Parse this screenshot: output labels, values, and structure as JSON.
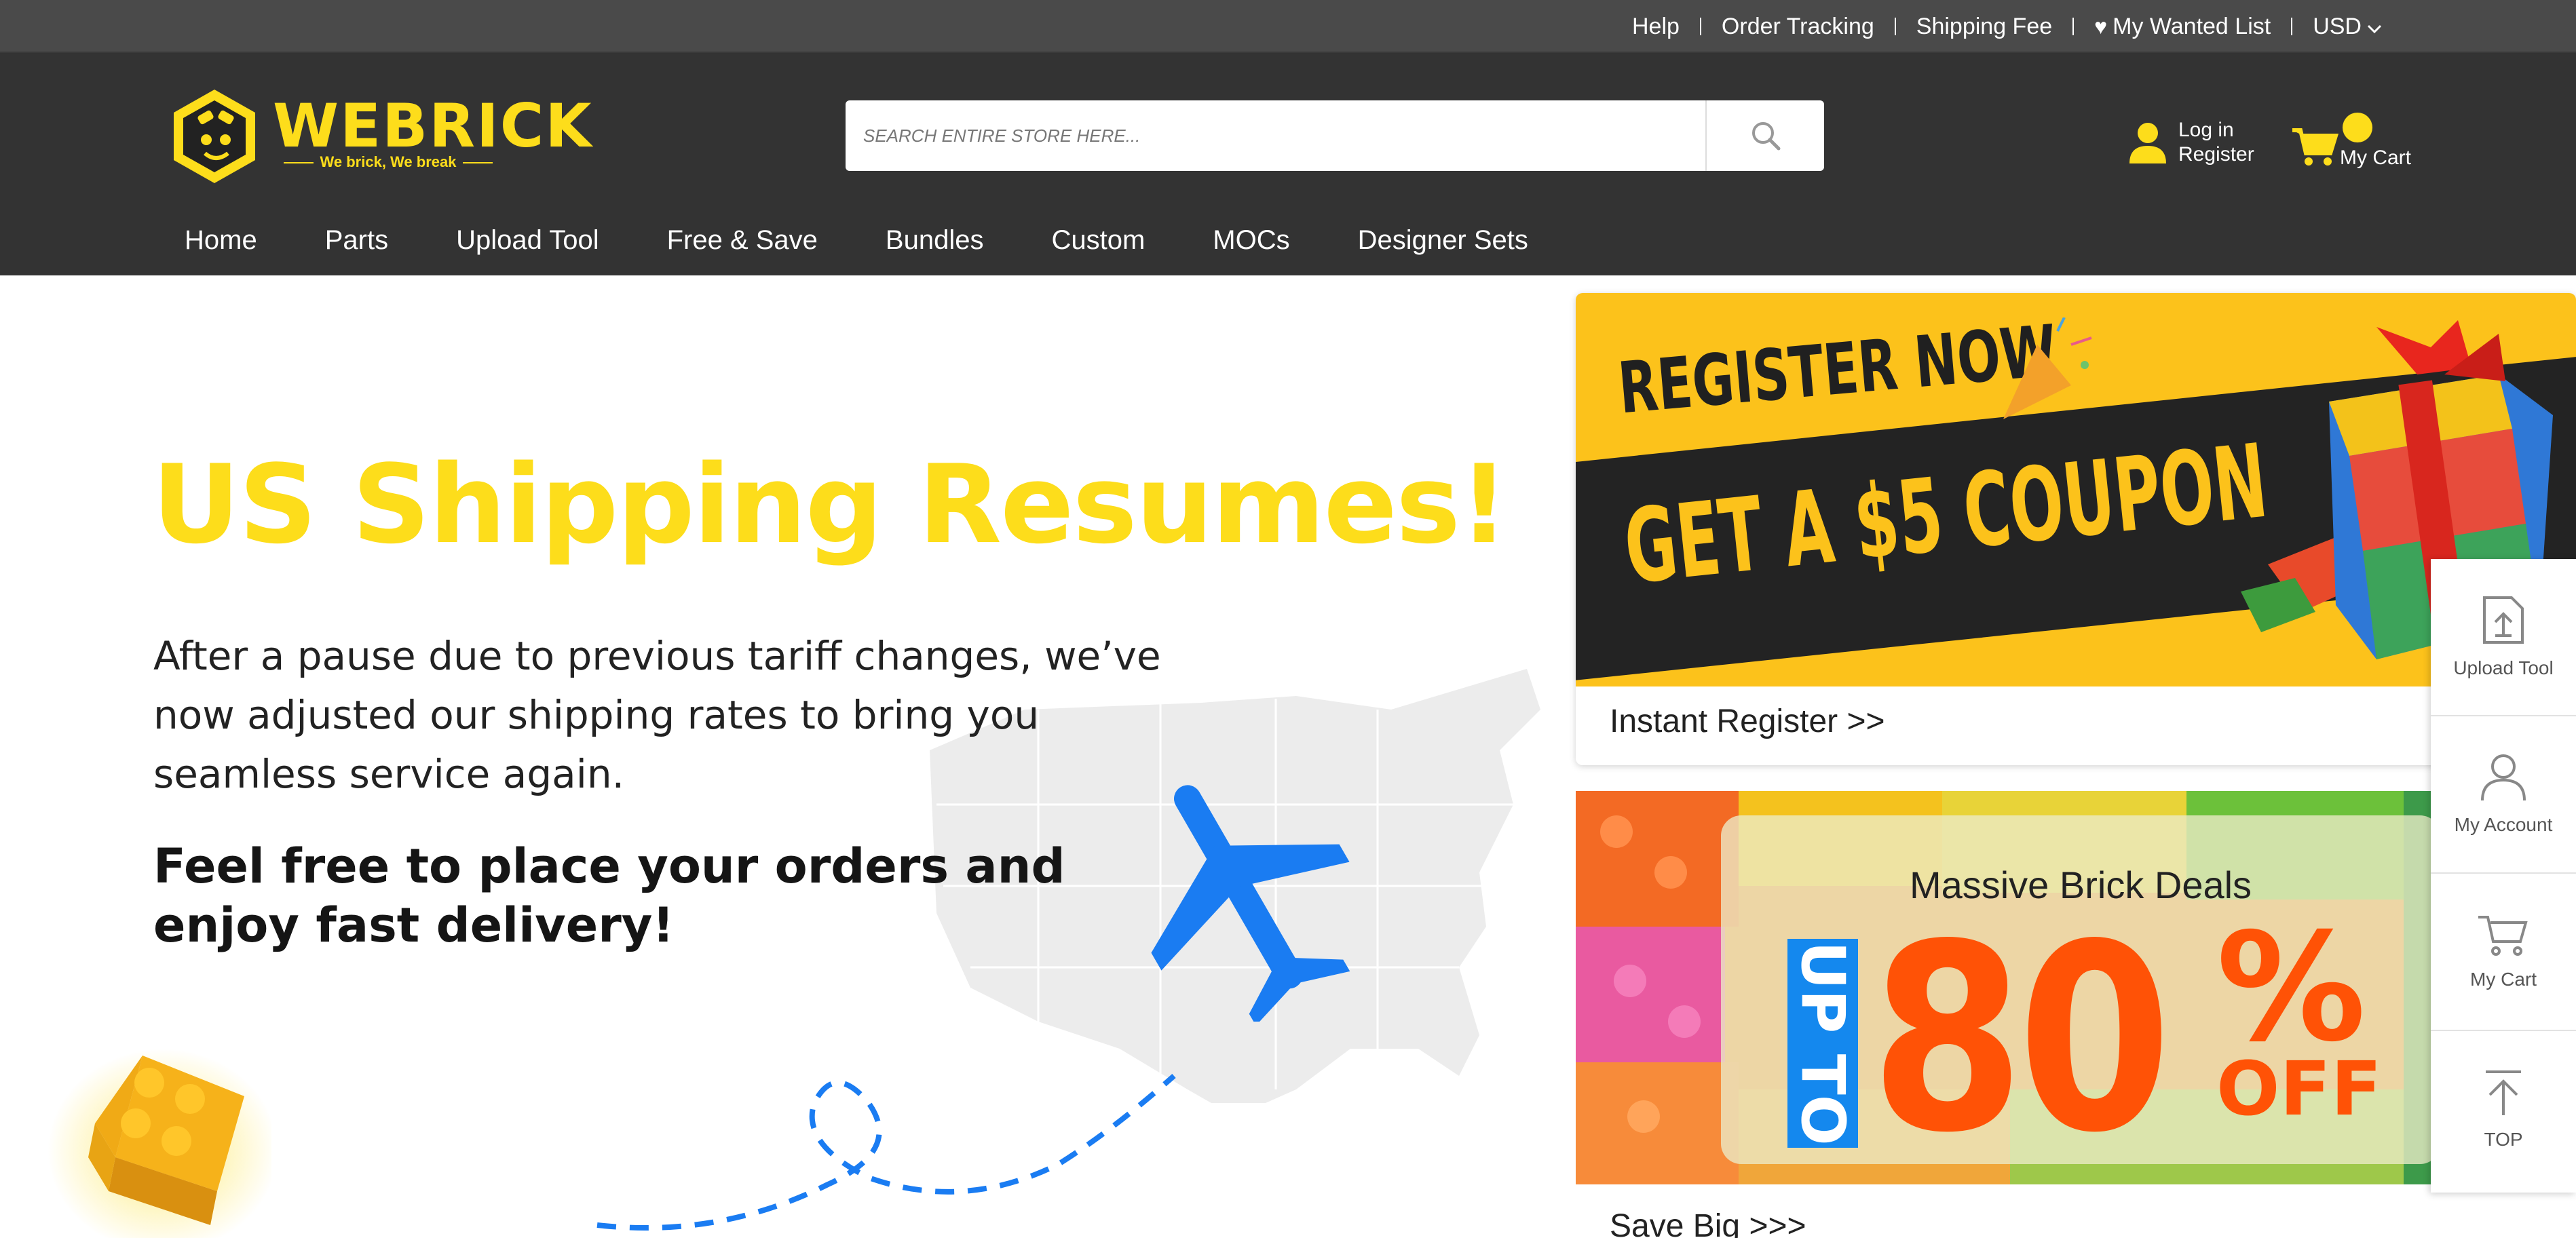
{
  "topbar": {
    "links": [
      "Help",
      "Order Tracking",
      "Shipping Fee",
      "My Wanted List",
      "USD"
    ]
  },
  "header": {
    "logo_text": "WEBRICK",
    "logo_tagline": "We brick, We break",
    "search": {
      "placeholder": "SEARCH ENTIRE STORE HERE..."
    },
    "account": {
      "login": "Log in",
      "register": "Register"
    },
    "cart": {
      "label": "My Cart"
    }
  },
  "nav": {
    "items": [
      "Home",
      "Parts",
      "Upload Tool",
      "Free & Save",
      "Bundles",
      "Custom",
      "MOCs",
      "Designer Sets"
    ]
  },
  "hero": {
    "title": "US Shipping Resumes!",
    "body": "After a pause due to previous tariff changes, we’ve now adjusted our shipping rates to bring you seamless service again.",
    "cta": "Feel free to place your orders and enjoy fast delivery!"
  },
  "promo_register": {
    "headline": "REGISTER NOW",
    "subline": "GET A $5 COUPON",
    "link": "Instant Register >>"
  },
  "promo_deals": {
    "headline": "Massive Brick Deals",
    "up_to": "UP TO",
    "number": "80",
    "percent": "%",
    "off": "OFF",
    "link": "Save Big >>>"
  },
  "sidebar": {
    "items": [
      "Upload Tool",
      "My Account",
      "My Cart",
      "TOP"
    ]
  },
  "colors": {
    "brand_yellow": "#fddd1b",
    "header_dark": "#333333",
    "topbar": "#4a4a4a",
    "deal_orange": "#ff5206",
    "plane_blue": "#1a7cf2"
  }
}
